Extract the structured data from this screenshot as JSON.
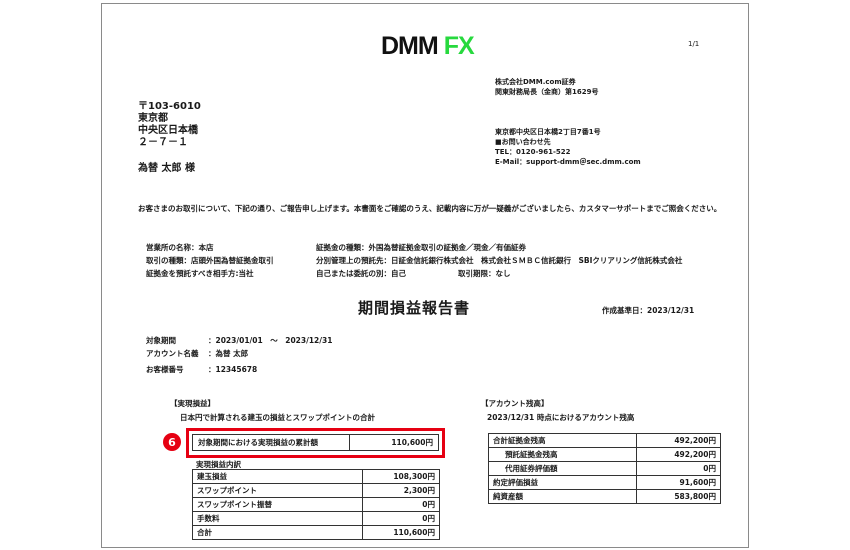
{
  "logo": {
    "dmm": "DMM",
    "fx": "FX"
  },
  "page_number": "1/1",
  "recipient": {
    "postal": "〒103-6010",
    "pref": "東京都",
    "ward": "中央区日本橋",
    "block": "２－７－１",
    "name": "為替 太郎 様"
  },
  "company": {
    "name": "株式会社DMM.com証券",
    "registration": "関東財務局長（金商）第1629号"
  },
  "contact": {
    "address": "東京都中央区日本橋2丁目7番1号",
    "inquiry": "■お問い合わせ先",
    "tel": "TEL：0120-961-522",
    "email": "E-Mail：support-dmm＠sec.dmm.com"
  },
  "intro": "お客さまのお取引について、下記の通り、ご報告申し上げます。本書面をご確認のうえ、記載内容に万が一疑義がございましたら、カスタマーサポートまでご照会ください。",
  "info": {
    "office": "営業所の名称：本店",
    "trade_type": "取引の種類：店頭外国為替証拠金取引",
    "deposit_party": "証拠金を預託すべき相手方:当社",
    "margin_type": "証拠金の種類：外国為替証拠金取引の証拠金／現金／有価証券",
    "segregation": "分別管理上の預託先：日証金信託銀行株式会社　株式会社ＳＭＢＣ信託銀行　SBIクリアリング信託株式会社",
    "self_or_consign": "自己または委託の別：自己",
    "deadline": "取引期限：なし"
  },
  "title": "期間損益報告書",
  "created": "作成基準日：2023/12/31",
  "account": {
    "period_label": "対象期間",
    "period_value": "：2023/01/01　～　2023/12/31",
    "name_label": "アカウント名義",
    "name_value": "：為替 太郎",
    "number_label": "お客様番号",
    "number_value": "：12345678"
  },
  "realized": {
    "section": "【実現損益】",
    "subtitle": "日本円で計算される建玉の損益とスワップポイントの合計",
    "total_label": "対象期間における実現損益の累計額",
    "total_value": "110,600円",
    "breakdown_label": "実現損益内訳",
    "badge": "6",
    "rows": [
      {
        "label": "建玉損益",
        "value": "108,300円"
      },
      {
        "label": "スワップポイント",
        "value": "2,300円"
      },
      {
        "label": "スワップポイント振替",
        "value": "0円"
      },
      {
        "label": "手数料",
        "value": "0円"
      },
      {
        "label": "合計",
        "value": "110,600円"
      }
    ]
  },
  "balance": {
    "section": "【アカウント残高】",
    "subtitle": "2023/12/31 時点におけるアカウント残高",
    "rows": [
      {
        "label": "合計証拠金残高",
        "value": "492,200円",
        "indent": false
      },
      {
        "label": "預託証拠金残高",
        "value": "492,200円",
        "indent": true
      },
      {
        "label": "代用証券評価額",
        "value": "0円",
        "indent": true
      },
      {
        "label": "約定評価損益",
        "value": "91,600円",
        "indent": false
      },
      {
        "label": "純資産額",
        "value": "583,800円",
        "indent": false
      }
    ]
  },
  "colors": {
    "accent_red": "#e60012",
    "logo_green": "#27d93e"
  }
}
